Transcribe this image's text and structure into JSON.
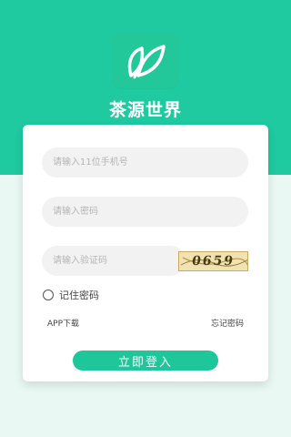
{
  "colors": {
    "brand": "#1fcaa0",
    "background": "#e9f8f3",
    "button": "#1dc79a"
  },
  "app": {
    "title": "茶源世界",
    "logo_icon": "leaf-icon"
  },
  "form": {
    "phone_placeholder": "请输入11位手机号",
    "password_placeholder": "请输入密码",
    "captcha_placeholder": "请输入验证码",
    "captcha_code": "0659",
    "remember_label": "记住密码",
    "app_download": "APP下载",
    "forgot_password": "忘记密码",
    "login_label": "立即登入"
  }
}
